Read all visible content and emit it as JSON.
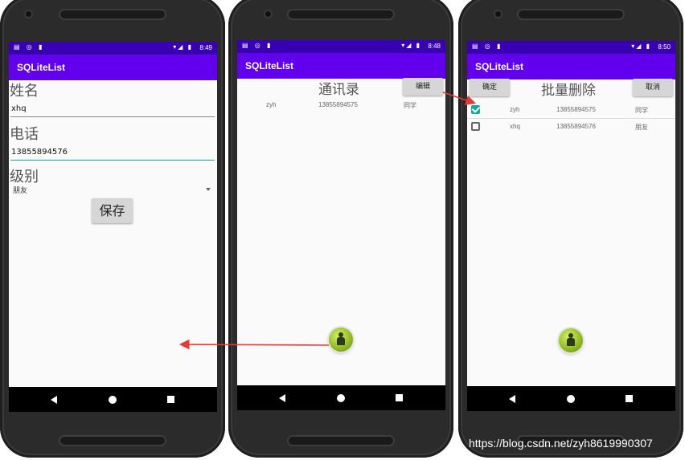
{
  "colors": {
    "status_bar": "#3700b3",
    "app_bar": "#6200ee",
    "accent": "#14a89f",
    "arrow": "#e53935"
  },
  "status_icons": "▤ ◎ ▮",
  "signal_icons": "▾◢ ▮",
  "screens": [
    {
      "time": "8:49",
      "app_title": "SQLiteList",
      "name_label": "姓名",
      "name_value": "xhq",
      "phone_label": "电话",
      "phone_value": "13855894576",
      "level_label": "级别",
      "level_value": "朋友",
      "save_button": "保存"
    },
    {
      "time": "8:48",
      "app_title": "SQLiteList",
      "title": "通讯录",
      "edit_button": "编辑",
      "rows": [
        {
          "name": "zyh",
          "phone": "13855894575",
          "group": "同学"
        }
      ]
    },
    {
      "time": "8:50",
      "app_title": "SQLiteList",
      "confirm_button": "确定",
      "title": "批量删除",
      "cancel_button": "取消",
      "rows": [
        {
          "name": "zyh",
          "phone": "13855894575",
          "group": "同学",
          "checked": true
        },
        {
          "name": "xhq",
          "phone": "13855894576",
          "group": "朋友",
          "checked": false
        }
      ]
    }
  ],
  "watermark": "https://blog.csdn.net/zyh8619990307"
}
